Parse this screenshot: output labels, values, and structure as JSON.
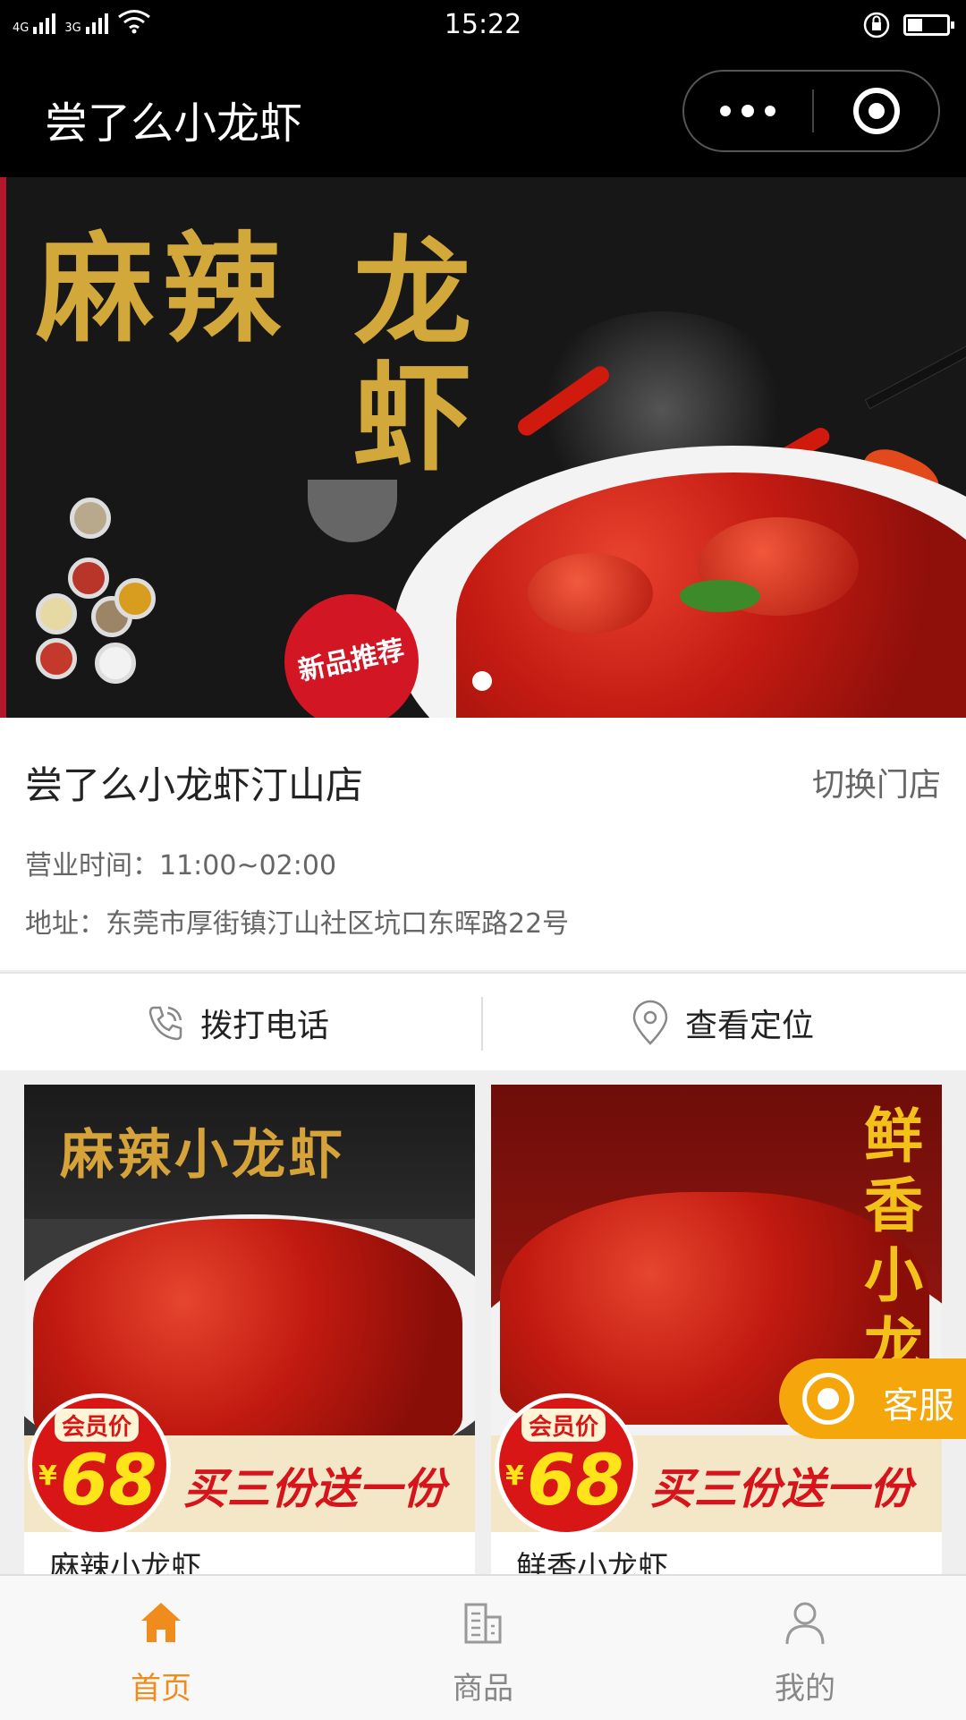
{
  "status_bar": {
    "signal_1": "4G",
    "signal_2": "3G",
    "time": "15:22",
    "battery_level": 0.35
  },
  "nav": {
    "title": "尝了么小龙虾"
  },
  "banner": {
    "headline_left": "麻辣",
    "headline_right": "龙虾",
    "stamp_text": "新品推荐",
    "indicator_count": 1,
    "active_indicator": 0
  },
  "store": {
    "name": "尝了么小龙虾汀山店",
    "switch_label": "切换门店",
    "hours": "营业时间：11:00~02:00",
    "address": "地址：东莞市厚街镇汀山社区坑口东晖路22号"
  },
  "actions": {
    "call_label": "拨打电话",
    "location_label": "查看定位"
  },
  "products": [
    {
      "image_title": "麻辣小龙虾",
      "member_label": "会员价",
      "currency": "¥",
      "price": "68",
      "promo": "买三份送一份",
      "name": "麻辣小龙虾"
    },
    {
      "image_title": "鲜香小龙",
      "member_label": "会员价",
      "currency": "¥",
      "price": "68",
      "promo": "买三份送一份",
      "name": "鲜香小龙虾"
    }
  ],
  "service": {
    "label": "客服"
  },
  "tabbar": {
    "items": [
      {
        "label": "首页",
        "icon": "home-icon",
        "active": true
      },
      {
        "label": "商品",
        "icon": "building-icon",
        "active": false
      },
      {
        "label": "我的",
        "icon": "user-icon",
        "active": false
      }
    ]
  },
  "colors": {
    "accent": "#f08c1e",
    "service_bg": "#f5a60b",
    "price_red": "#d81616",
    "gold": "#d3a83a"
  }
}
